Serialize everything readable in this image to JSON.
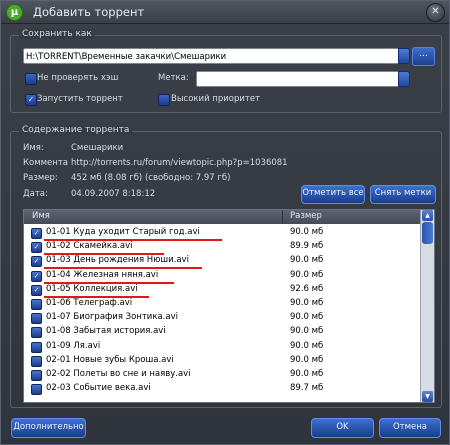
{
  "window": {
    "title": "Добавить торрент",
    "icon": "µ",
    "close": "✕"
  },
  "save_as": {
    "legend": "Сохранить как",
    "path": "H:\\TORRENT\\Временные закачки\\Смешарики",
    "browse_label": "..."
  },
  "options": {
    "skip_hash": {
      "label": "Не проверять хэш",
      "checked": false
    },
    "start_torrent": {
      "label": "Запустить торрент",
      "checked": true
    },
    "tag_label": "Метка:",
    "tag_value": "",
    "high_priority": {
      "label": "Высокий приоритет",
      "checked": false
    }
  },
  "contents": {
    "legend": "Содержание торрента",
    "name_label": "Имя:",
    "name_value": "Смешарики",
    "comment_label": "Коммента",
    "comment_value": "http://torrents.ru/forum/viewtopic.php?p=1036081",
    "size_label": "Размер:",
    "size_value": "452 мб (8.08 гб) (свободно: 7.97 гб)",
    "date_label": "Дата:",
    "date_value": "04.09.2007 8:18:12",
    "mark_all_label": "Отметить все",
    "unmark_label": "Снять метки"
  },
  "file_list": {
    "col_name": "Имя",
    "col_size": "Размер",
    "rows": [
      {
        "name": "01-01 Куда уходит Старый год.avi",
        "size": "90.0 мб",
        "checked": true,
        "underlined": true
      },
      {
        "name": "01-02 Скамейка.avi",
        "size": "89.9 мб",
        "checked": true,
        "underlined": true
      },
      {
        "name": "01-03 День рождения Нюши.avi",
        "size": "90.0 мб",
        "checked": true,
        "underlined": true
      },
      {
        "name": "01-04 Железная няня.avi",
        "size": "90.0 мб",
        "checked": true,
        "underlined": true
      },
      {
        "name": "01-05 Коллекция.avi",
        "size": "92.6 мб",
        "checked": true,
        "underlined": true
      },
      {
        "name": "01-06 Телеграф.avi",
        "size": "90.0 мб",
        "checked": false,
        "underlined": false
      },
      {
        "name": "01-07 Биография Зонтика.avi",
        "size": "90.0 мб",
        "checked": false,
        "underlined": false
      },
      {
        "name": "01-08 Забытая история.avi",
        "size": "90.0 мб",
        "checked": false,
        "underlined": false
      },
      {
        "name": "01-09 Ля.avi",
        "size": "90.0 мб",
        "checked": false,
        "underlined": false
      },
      {
        "name": "02-01 Новые зубы Кроша.avi",
        "size": "90.0 мб",
        "checked": false,
        "underlined": false
      },
      {
        "name": "02-02 Полеты во сне и наяву.avi",
        "size": "90.0 мб",
        "checked": false,
        "underlined": false
      },
      {
        "name": "02-03 Событие века.avi",
        "size": "89.7 мб",
        "checked": false,
        "underlined": false
      }
    ]
  },
  "footer": {
    "advanced_label": "Дополнительно",
    "ok_label": "OK",
    "cancel_label": "Отмена"
  },
  "colors": {
    "accent": "#2a55ad",
    "underline": "#e01818",
    "background": "#363a42"
  }
}
